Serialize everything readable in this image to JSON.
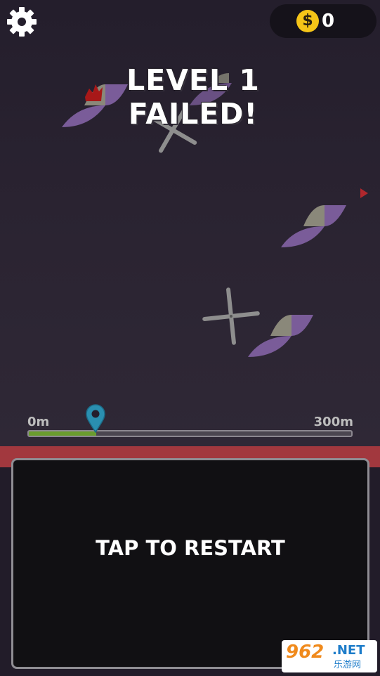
{
  "hud": {
    "settings_icon": "gear-icon",
    "coin_symbol": "$",
    "coin_count": "0"
  },
  "result": {
    "line1": "LEVEL 1",
    "line2": "FAILED!"
  },
  "progress": {
    "start_label": "0m",
    "end_label": "300m",
    "fraction": 0.21,
    "marker_icon": "location-pin-icon"
  },
  "restart": {
    "label": "TAP TO RESTART"
  },
  "watermark": {
    "number": "962",
    "domain": ".NET",
    "site": "乐游网"
  },
  "colors": {
    "background": "#221c29",
    "obstacle_purple": "#7a5c99",
    "obstacle_grey": "#8a887a",
    "blood": "#a81818",
    "progress_fill": "#6a9c2e",
    "pin": "#2a8fb0",
    "danger_strip": "#a2383e",
    "coin": "#f5c518"
  }
}
